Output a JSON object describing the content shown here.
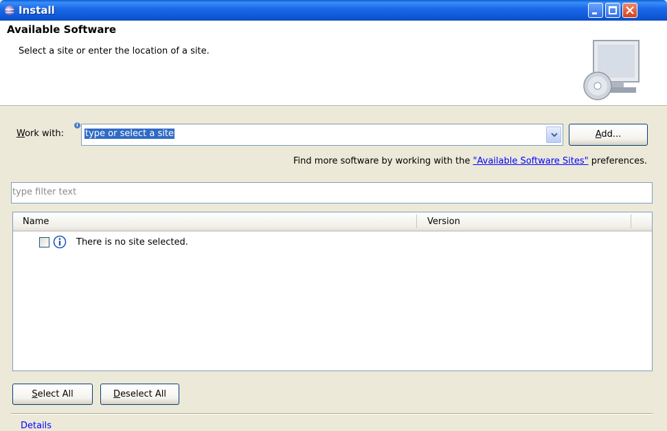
{
  "window": {
    "title": "Install"
  },
  "header": {
    "title": "Available Software",
    "description": "Select a site or enter the location of a site."
  },
  "work_with": {
    "label_prefix": "W",
    "label_rest": "ork with:",
    "info_glyph": "i",
    "value": "type or select a site"
  },
  "buttons": {
    "add_prefix": "A",
    "add_rest": "dd...",
    "select_all_prefix": "S",
    "select_all_rest": "elect All",
    "deselect_all_prefix": "D",
    "deselect_all_rest": "eselect All"
  },
  "find_more": {
    "before": "Find more software by working with the ",
    "link": "\"Available Software Sites\"",
    "after": " preferences."
  },
  "filter": {
    "placeholder": "type filter text"
  },
  "table": {
    "columns": [
      "Name",
      "Version"
    ],
    "rows": [
      {
        "checked": false,
        "icon": "info-icon",
        "text": "There is no site selected."
      }
    ]
  },
  "details": {
    "label": "Details"
  },
  "colors": {
    "title_bar": "#0f58d6",
    "selection": "#316ac5",
    "link": "#0000ff",
    "dialog_bg": "#ece9d8"
  }
}
